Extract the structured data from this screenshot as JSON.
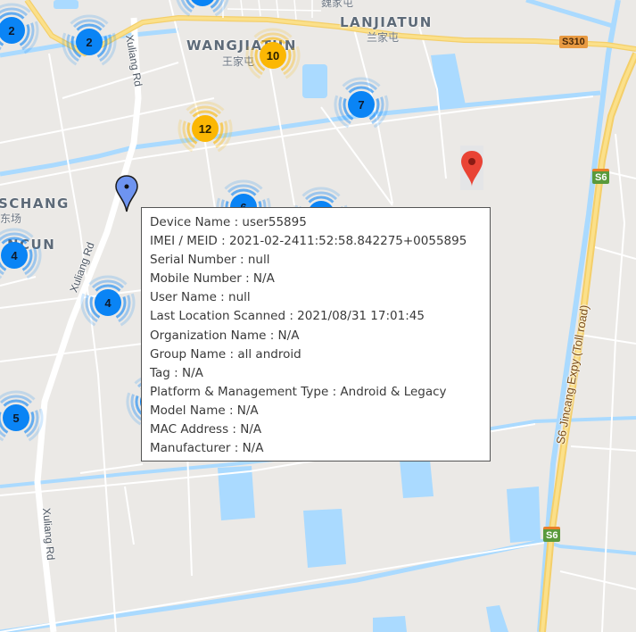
{
  "map": {
    "places": [
      {
        "name": "WANGJIATUN",
        "native": "王家屯"
      },
      {
        "name": "LANJIATUN",
        "native": "兰家屯"
      },
      {
        "name": "SCHANG",
        "native": "东场"
      },
      {
        "name": "NCUN",
        "native": ""
      },
      {
        "name": "",
        "native": "魏家屯"
      }
    ],
    "roads": {
      "xuliang_1": "Xuliang Rd",
      "xuliang_2": "Xuliang Rd",
      "xuliang_3": "Xuliang Rd",
      "expressway": "S6 Jincang Expy (Toll road)"
    },
    "shields": {
      "s310": "S310",
      "s6_top": "S6",
      "s6_bottom": "S6"
    },
    "clusters": [
      {
        "count": "2",
        "color": "blue"
      },
      {
        "count": "2",
        "color": "blue"
      },
      {
        "count": "",
        "color": "blue"
      },
      {
        "count": "10",
        "color": "yellow"
      },
      {
        "count": "12",
        "color": "yellow"
      },
      {
        "count": "7",
        "color": "blue"
      },
      {
        "count": "4",
        "color": "blue"
      },
      {
        "count": "4",
        "color": "blue"
      },
      {
        "count": "5",
        "color": "blue"
      },
      {
        "count": "6",
        "color": "blue"
      },
      {
        "count": "",
        "color": "blue"
      },
      {
        "count": "",
        "color": "blue"
      }
    ],
    "colors": {
      "land": "#ebe9e6",
      "water": "#aadaff",
      "road": "#ffffff",
      "highway": "#fbe08a",
      "cluster_blue": "#0a84f5",
      "cluster_yellow": "#fbb704",
      "pin_selected": "#6e94f0",
      "pin_red": "#e94335"
    }
  },
  "infowindow": {
    "lines": [
      "Device Name : user55895",
      "IMEI / MEID : 2021-02-2411:52:58.842275+0055895",
      "Serial Number : null",
      "Mobile Number : N/A",
      "User Name : null",
      "Last Location Scanned : 2021/08/31 17:01:45",
      "Organization Name : N/A",
      "Group Name : all android",
      "Tag : N/A",
      "Platform & Management Type : Android & Legacy",
      "Model Name : N/A",
      "MAC Address : N/A",
      "Manufacturer : N/A"
    ]
  }
}
